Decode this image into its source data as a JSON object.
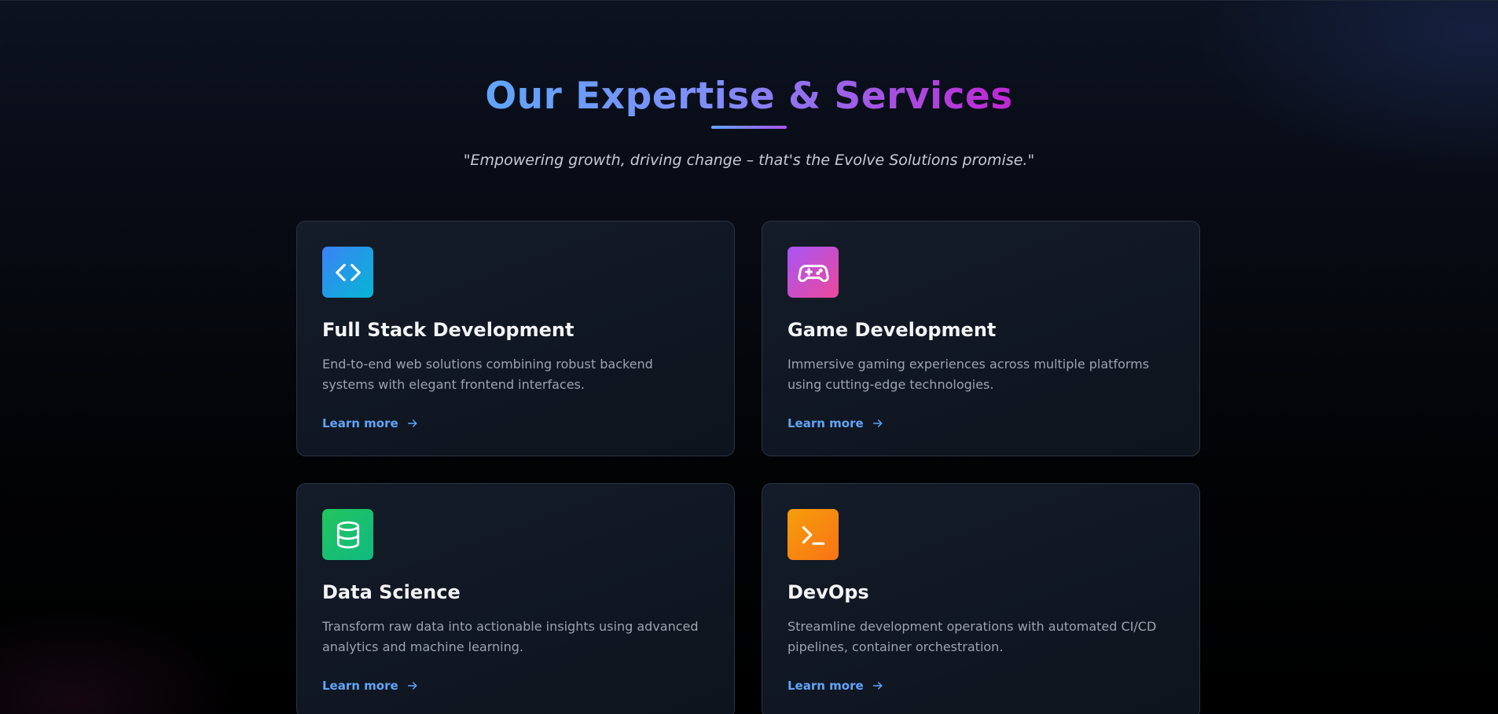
{
  "section": {
    "title": "Our Expertise & Services",
    "tagline": "\"Empowering growth, driving change – that's the Evolve Solutions promise.\""
  },
  "services": [
    {
      "title": "Full Stack Development",
      "description": "End-to-end web solutions combining robust backend systems with elegant frontend interfaces.",
      "link_label": "Learn more",
      "icon": "code-icon",
      "colors": [
        "#3b82f6",
        "#06b6d4"
      ]
    },
    {
      "title": "Game Development",
      "description": "Immersive gaming experiences across multiple platforms using cutting-edge technologies.",
      "link_label": "Learn more",
      "icon": "gamepad-icon",
      "colors": [
        "#a855f7",
        "#ec4899"
      ]
    },
    {
      "title": "Data Science",
      "description": "Transform raw data into actionable insights using advanced analytics and machine learning.",
      "link_label": "Learn more",
      "icon": "database-icon",
      "colors": [
        "#22c55e",
        "#10b981"
      ]
    },
    {
      "title": "DevOps",
      "description": "Streamline development operations with automated CI/CD pipelines, container orchestration.",
      "link_label": "Learn more",
      "icon": "terminal-icon",
      "colors": [
        "#f59e0b",
        "#f97316"
      ]
    }
  ],
  "theme": {
    "accent": "#60a5fa",
    "title_gradient": [
      "#60a5fa",
      "#a855f7"
    ]
  }
}
